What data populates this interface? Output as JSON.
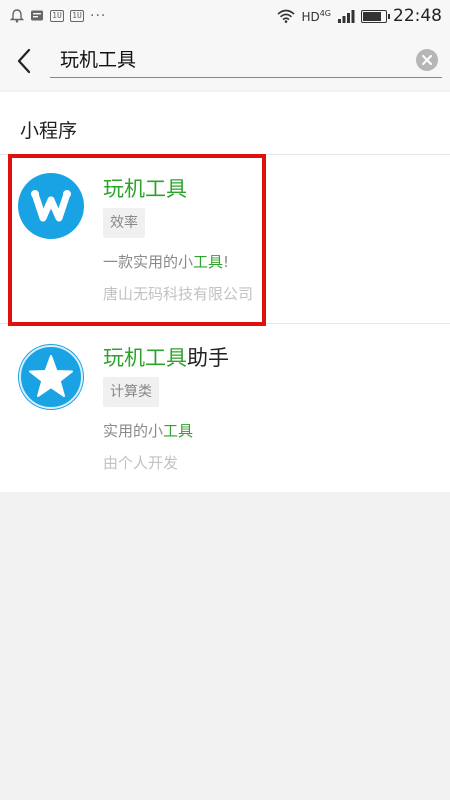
{
  "status_bar": {
    "network_label": "HD",
    "network_type": "4G",
    "time": "22:48",
    "left_icons": [
      "notification-bell-icon",
      "message-icon",
      "app-badge-icon",
      "app-badge-icon",
      "more-dots-icon"
    ],
    "mini_badges": [
      "1U",
      "1U"
    ],
    "dots": "···"
  },
  "search": {
    "query": "玩机工具",
    "accent_color": "#3bbf30"
  },
  "results": {
    "section_title": "小程序",
    "items": [
      {
        "name_highlight": "玩机工具",
        "name_rest": "",
        "tag": "效率",
        "desc_prefix": "一款实用的小",
        "desc_highlight": "工具",
        "desc_suffix": "!",
        "developer": "唐山无码科技有限公司",
        "icon": "w-logo-icon",
        "icon_color": "#1aa3e4"
      },
      {
        "name_highlight": "玩机工具",
        "name_rest": "助手",
        "tag": "计算类",
        "desc_prefix": "实用的小",
        "desc_highlight": "工具",
        "desc_suffix": "",
        "developer": "由个人开发",
        "icon": "star-icon",
        "icon_color": "#1aa3e4"
      }
    ]
  },
  "colors": {
    "highlight_green": "#2ea32b",
    "annotation_red": "#e01010",
    "background": "#f2f2f2"
  }
}
